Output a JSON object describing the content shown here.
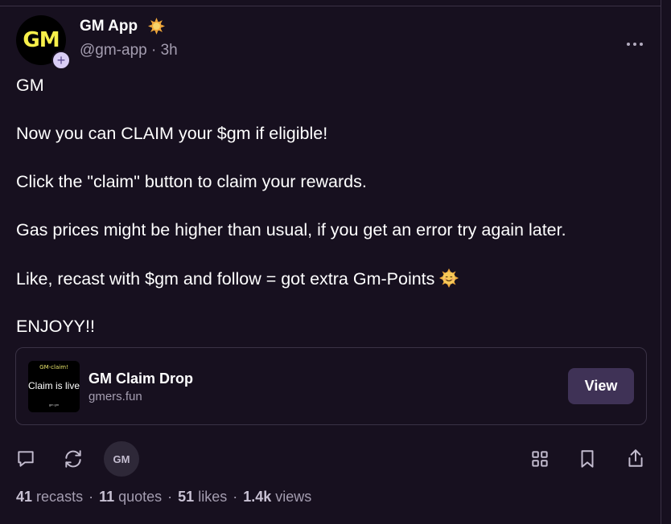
{
  "post": {
    "author_name": "GM App",
    "handle_time": "@gm-app · 3h",
    "avatar_text": "GM",
    "follow_badge": "+",
    "lines": [
      "GM",
      "Now you can CLAIM your $gm if eligible!",
      "Click the \"claim\" button to claim your rewards.",
      "Gas prices might be higher than usual, if you get an error try again later.",
      "Like, recast with $gm and follow = got extra Gm-Points",
      "ENJOYY!!"
    ]
  },
  "embed": {
    "thumb_top": "GM-claim!",
    "thumb_mid": "Claim is live",
    "thumb_bottom": "gm gm",
    "title": "GM Claim Drop",
    "domain": "gmers.fun",
    "button_label": "View"
  },
  "actions": {
    "gm_chip": "GM"
  },
  "stats": {
    "recasts_count": "41",
    "recasts_label": "recasts",
    "quotes_count": "11",
    "quotes_label": "quotes",
    "likes_count": "51",
    "likes_label": "likes",
    "views_count": "1.4k",
    "views_label": "views",
    "separator": "·"
  },
  "icons": {
    "verified": "sun-badge-icon",
    "more": "more-horizontal-icon",
    "reply": "comment-icon",
    "recast": "recast-icon",
    "grid": "apps-grid-icon",
    "bookmark": "bookmark-icon",
    "share": "share-icon",
    "emoji": "smiling-sun-emoji"
  },
  "colors": {
    "background": "#17101f",
    "accent_button": "#3f3256",
    "muted_text": "#a49db0",
    "avatar_text": "#f7f04a"
  }
}
